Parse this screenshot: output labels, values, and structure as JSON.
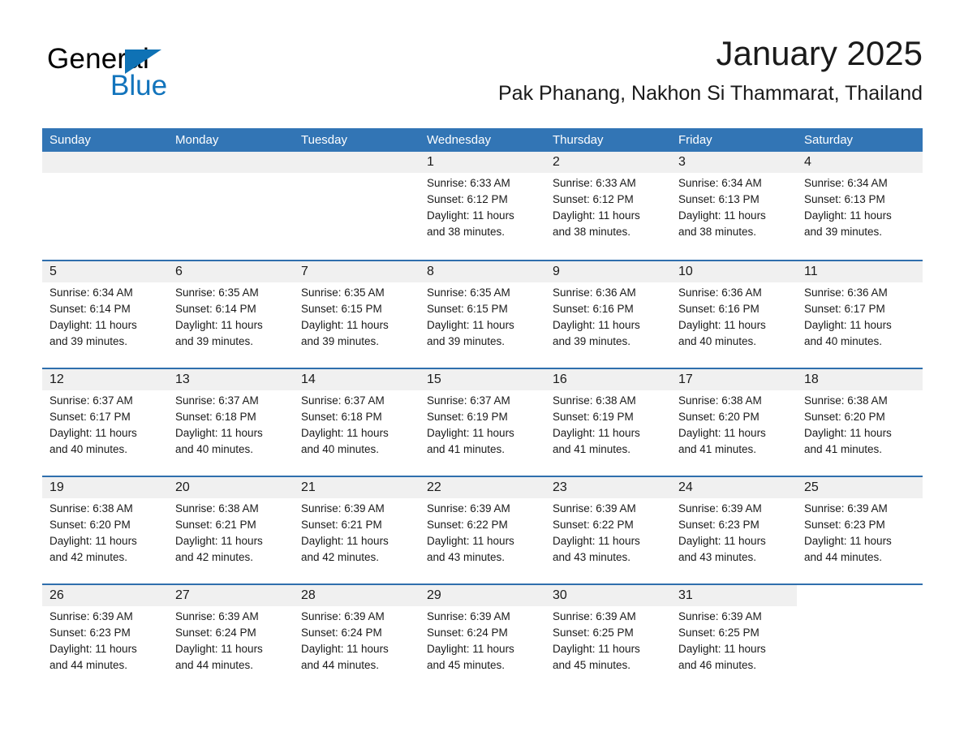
{
  "brand": {
    "name_part1": "General",
    "name_part2": "Blue",
    "triangle_color": "#0f72b5",
    "blue_color": "#1274bc"
  },
  "header": {
    "title": "January 2025",
    "subtitle": "Pak Phanang, Nakhon Si Thammarat, Thailand"
  },
  "theme": {
    "header_blue": "#3275b5",
    "row_rule_blue": "#2f6fad",
    "daynum_band": "#f0f0f0"
  },
  "weekdays": [
    "Sunday",
    "Monday",
    "Tuesday",
    "Wednesday",
    "Thursday",
    "Friday",
    "Saturday"
  ],
  "weeks": [
    [
      {
        "day": "",
        "sunrise": "",
        "sunset": "",
        "daylight_line1": "",
        "daylight_line2": ""
      },
      {
        "day": "",
        "sunrise": "",
        "sunset": "",
        "daylight_line1": "",
        "daylight_line2": ""
      },
      {
        "day": "",
        "sunrise": "",
        "sunset": "",
        "daylight_line1": "",
        "daylight_line2": ""
      },
      {
        "day": "1",
        "sunrise": "Sunrise: 6:33 AM",
        "sunset": "Sunset: 6:12 PM",
        "daylight_line1": "Daylight: 11 hours",
        "daylight_line2": "and 38 minutes."
      },
      {
        "day": "2",
        "sunrise": "Sunrise: 6:33 AM",
        "sunset": "Sunset: 6:12 PM",
        "daylight_line1": "Daylight: 11 hours",
        "daylight_line2": "and 38 minutes."
      },
      {
        "day": "3",
        "sunrise": "Sunrise: 6:34 AM",
        "sunset": "Sunset: 6:13 PM",
        "daylight_line1": "Daylight: 11 hours",
        "daylight_line2": "and 38 minutes."
      },
      {
        "day": "4",
        "sunrise": "Sunrise: 6:34 AM",
        "sunset": "Sunset: 6:13 PM",
        "daylight_line1": "Daylight: 11 hours",
        "daylight_line2": "and 39 minutes."
      }
    ],
    [
      {
        "day": "5",
        "sunrise": "Sunrise: 6:34 AM",
        "sunset": "Sunset: 6:14 PM",
        "daylight_line1": "Daylight: 11 hours",
        "daylight_line2": "and 39 minutes."
      },
      {
        "day": "6",
        "sunrise": "Sunrise: 6:35 AM",
        "sunset": "Sunset: 6:14 PM",
        "daylight_line1": "Daylight: 11 hours",
        "daylight_line2": "and 39 minutes."
      },
      {
        "day": "7",
        "sunrise": "Sunrise: 6:35 AM",
        "sunset": "Sunset: 6:15 PM",
        "daylight_line1": "Daylight: 11 hours",
        "daylight_line2": "and 39 minutes."
      },
      {
        "day": "8",
        "sunrise": "Sunrise: 6:35 AM",
        "sunset": "Sunset: 6:15 PM",
        "daylight_line1": "Daylight: 11 hours",
        "daylight_line2": "and 39 minutes."
      },
      {
        "day": "9",
        "sunrise": "Sunrise: 6:36 AM",
        "sunset": "Sunset: 6:16 PM",
        "daylight_line1": "Daylight: 11 hours",
        "daylight_line2": "and 39 minutes."
      },
      {
        "day": "10",
        "sunrise": "Sunrise: 6:36 AM",
        "sunset": "Sunset: 6:16 PM",
        "daylight_line1": "Daylight: 11 hours",
        "daylight_line2": "and 40 minutes."
      },
      {
        "day": "11",
        "sunrise": "Sunrise: 6:36 AM",
        "sunset": "Sunset: 6:17 PM",
        "daylight_line1": "Daylight: 11 hours",
        "daylight_line2": "and 40 minutes."
      }
    ],
    [
      {
        "day": "12",
        "sunrise": "Sunrise: 6:37 AM",
        "sunset": "Sunset: 6:17 PM",
        "daylight_line1": "Daylight: 11 hours",
        "daylight_line2": "and 40 minutes."
      },
      {
        "day": "13",
        "sunrise": "Sunrise: 6:37 AM",
        "sunset": "Sunset: 6:18 PM",
        "daylight_line1": "Daylight: 11 hours",
        "daylight_line2": "and 40 minutes."
      },
      {
        "day": "14",
        "sunrise": "Sunrise: 6:37 AM",
        "sunset": "Sunset: 6:18 PM",
        "daylight_line1": "Daylight: 11 hours",
        "daylight_line2": "and 40 minutes."
      },
      {
        "day": "15",
        "sunrise": "Sunrise: 6:37 AM",
        "sunset": "Sunset: 6:19 PM",
        "daylight_line1": "Daylight: 11 hours",
        "daylight_line2": "and 41 minutes."
      },
      {
        "day": "16",
        "sunrise": "Sunrise: 6:38 AM",
        "sunset": "Sunset: 6:19 PM",
        "daylight_line1": "Daylight: 11 hours",
        "daylight_line2": "and 41 minutes."
      },
      {
        "day": "17",
        "sunrise": "Sunrise: 6:38 AM",
        "sunset": "Sunset: 6:20 PM",
        "daylight_line1": "Daylight: 11 hours",
        "daylight_line2": "and 41 minutes."
      },
      {
        "day": "18",
        "sunrise": "Sunrise: 6:38 AM",
        "sunset": "Sunset: 6:20 PM",
        "daylight_line1": "Daylight: 11 hours",
        "daylight_line2": "and 41 minutes."
      }
    ],
    [
      {
        "day": "19",
        "sunrise": "Sunrise: 6:38 AM",
        "sunset": "Sunset: 6:20 PM",
        "daylight_line1": "Daylight: 11 hours",
        "daylight_line2": "and 42 minutes."
      },
      {
        "day": "20",
        "sunrise": "Sunrise: 6:38 AM",
        "sunset": "Sunset: 6:21 PM",
        "daylight_line1": "Daylight: 11 hours",
        "daylight_line2": "and 42 minutes."
      },
      {
        "day": "21",
        "sunrise": "Sunrise: 6:39 AM",
        "sunset": "Sunset: 6:21 PM",
        "daylight_line1": "Daylight: 11 hours",
        "daylight_line2": "and 42 minutes."
      },
      {
        "day": "22",
        "sunrise": "Sunrise: 6:39 AM",
        "sunset": "Sunset: 6:22 PM",
        "daylight_line1": "Daylight: 11 hours",
        "daylight_line2": "and 43 minutes."
      },
      {
        "day": "23",
        "sunrise": "Sunrise: 6:39 AM",
        "sunset": "Sunset: 6:22 PM",
        "daylight_line1": "Daylight: 11 hours",
        "daylight_line2": "and 43 minutes."
      },
      {
        "day": "24",
        "sunrise": "Sunrise: 6:39 AM",
        "sunset": "Sunset: 6:23 PM",
        "daylight_line1": "Daylight: 11 hours",
        "daylight_line2": "and 43 minutes."
      },
      {
        "day": "25",
        "sunrise": "Sunrise: 6:39 AM",
        "sunset": "Sunset: 6:23 PM",
        "daylight_line1": "Daylight: 11 hours",
        "daylight_line2": "and 44 minutes."
      }
    ],
    [
      {
        "day": "26",
        "sunrise": "Sunrise: 6:39 AM",
        "sunset": "Sunset: 6:23 PM",
        "daylight_line1": "Daylight: 11 hours",
        "daylight_line2": "and 44 minutes."
      },
      {
        "day": "27",
        "sunrise": "Sunrise: 6:39 AM",
        "sunset": "Sunset: 6:24 PM",
        "daylight_line1": "Daylight: 11 hours",
        "daylight_line2": "and 44 minutes."
      },
      {
        "day": "28",
        "sunrise": "Sunrise: 6:39 AM",
        "sunset": "Sunset: 6:24 PM",
        "daylight_line1": "Daylight: 11 hours",
        "daylight_line2": "and 44 minutes."
      },
      {
        "day": "29",
        "sunrise": "Sunrise: 6:39 AM",
        "sunset": "Sunset: 6:24 PM",
        "daylight_line1": "Daylight: 11 hours",
        "daylight_line2": "and 45 minutes."
      },
      {
        "day": "30",
        "sunrise": "Sunrise: 6:39 AM",
        "sunset": "Sunset: 6:25 PM",
        "daylight_line1": "Daylight: 11 hours",
        "daylight_line2": "and 45 minutes."
      },
      {
        "day": "31",
        "sunrise": "Sunrise: 6:39 AM",
        "sunset": "Sunset: 6:25 PM",
        "daylight_line1": "Daylight: 11 hours",
        "daylight_line2": "and 46 minutes."
      },
      {
        "day": "",
        "sunrise": "",
        "sunset": "",
        "daylight_line1": "",
        "daylight_line2": ""
      }
    ]
  ]
}
